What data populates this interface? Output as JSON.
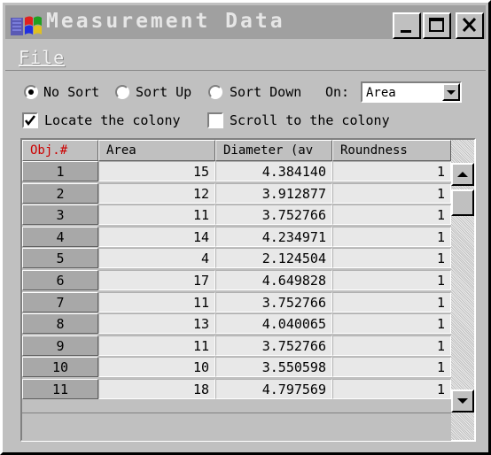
{
  "window": {
    "title": "Measurement Data"
  },
  "menu": {
    "file": "File"
  },
  "sort": {
    "no_sort": "No Sort",
    "sort_up": "Sort Up",
    "sort_down": "Sort Down",
    "on_label": "On:",
    "on_value": "Area"
  },
  "options": {
    "locate": "Locate the colony",
    "scroll": "Scroll to the colony",
    "locate_checked": true,
    "scroll_checked": false
  },
  "table": {
    "columns": [
      "Obj.#",
      "Area",
      "Diameter (av",
      "Roundness"
    ],
    "rows": [
      [
        "1",
        "15",
        "4.384140",
        "1"
      ],
      [
        "2",
        "12",
        "3.912877",
        "1"
      ],
      [
        "3",
        "11",
        "3.752766",
        "1"
      ],
      [
        "4",
        "14",
        "4.234971",
        "1"
      ],
      [
        "5",
        "4",
        "2.124504",
        "1"
      ],
      [
        "6",
        "17",
        "4.649828",
        "1"
      ],
      [
        "7",
        "11",
        "3.752766",
        "1"
      ],
      [
        "8",
        "13",
        "4.040065",
        "1"
      ],
      [
        "9",
        "11",
        "3.752766",
        "1"
      ],
      [
        "10",
        "10",
        "3.550598",
        "1"
      ],
      [
        "11",
        "18",
        "4.797569",
        "1"
      ]
    ]
  },
  "colors": {
    "header_accent": "#cc0000",
    "title_bar": "#a0a0a0",
    "face": "#c0c0c0"
  }
}
